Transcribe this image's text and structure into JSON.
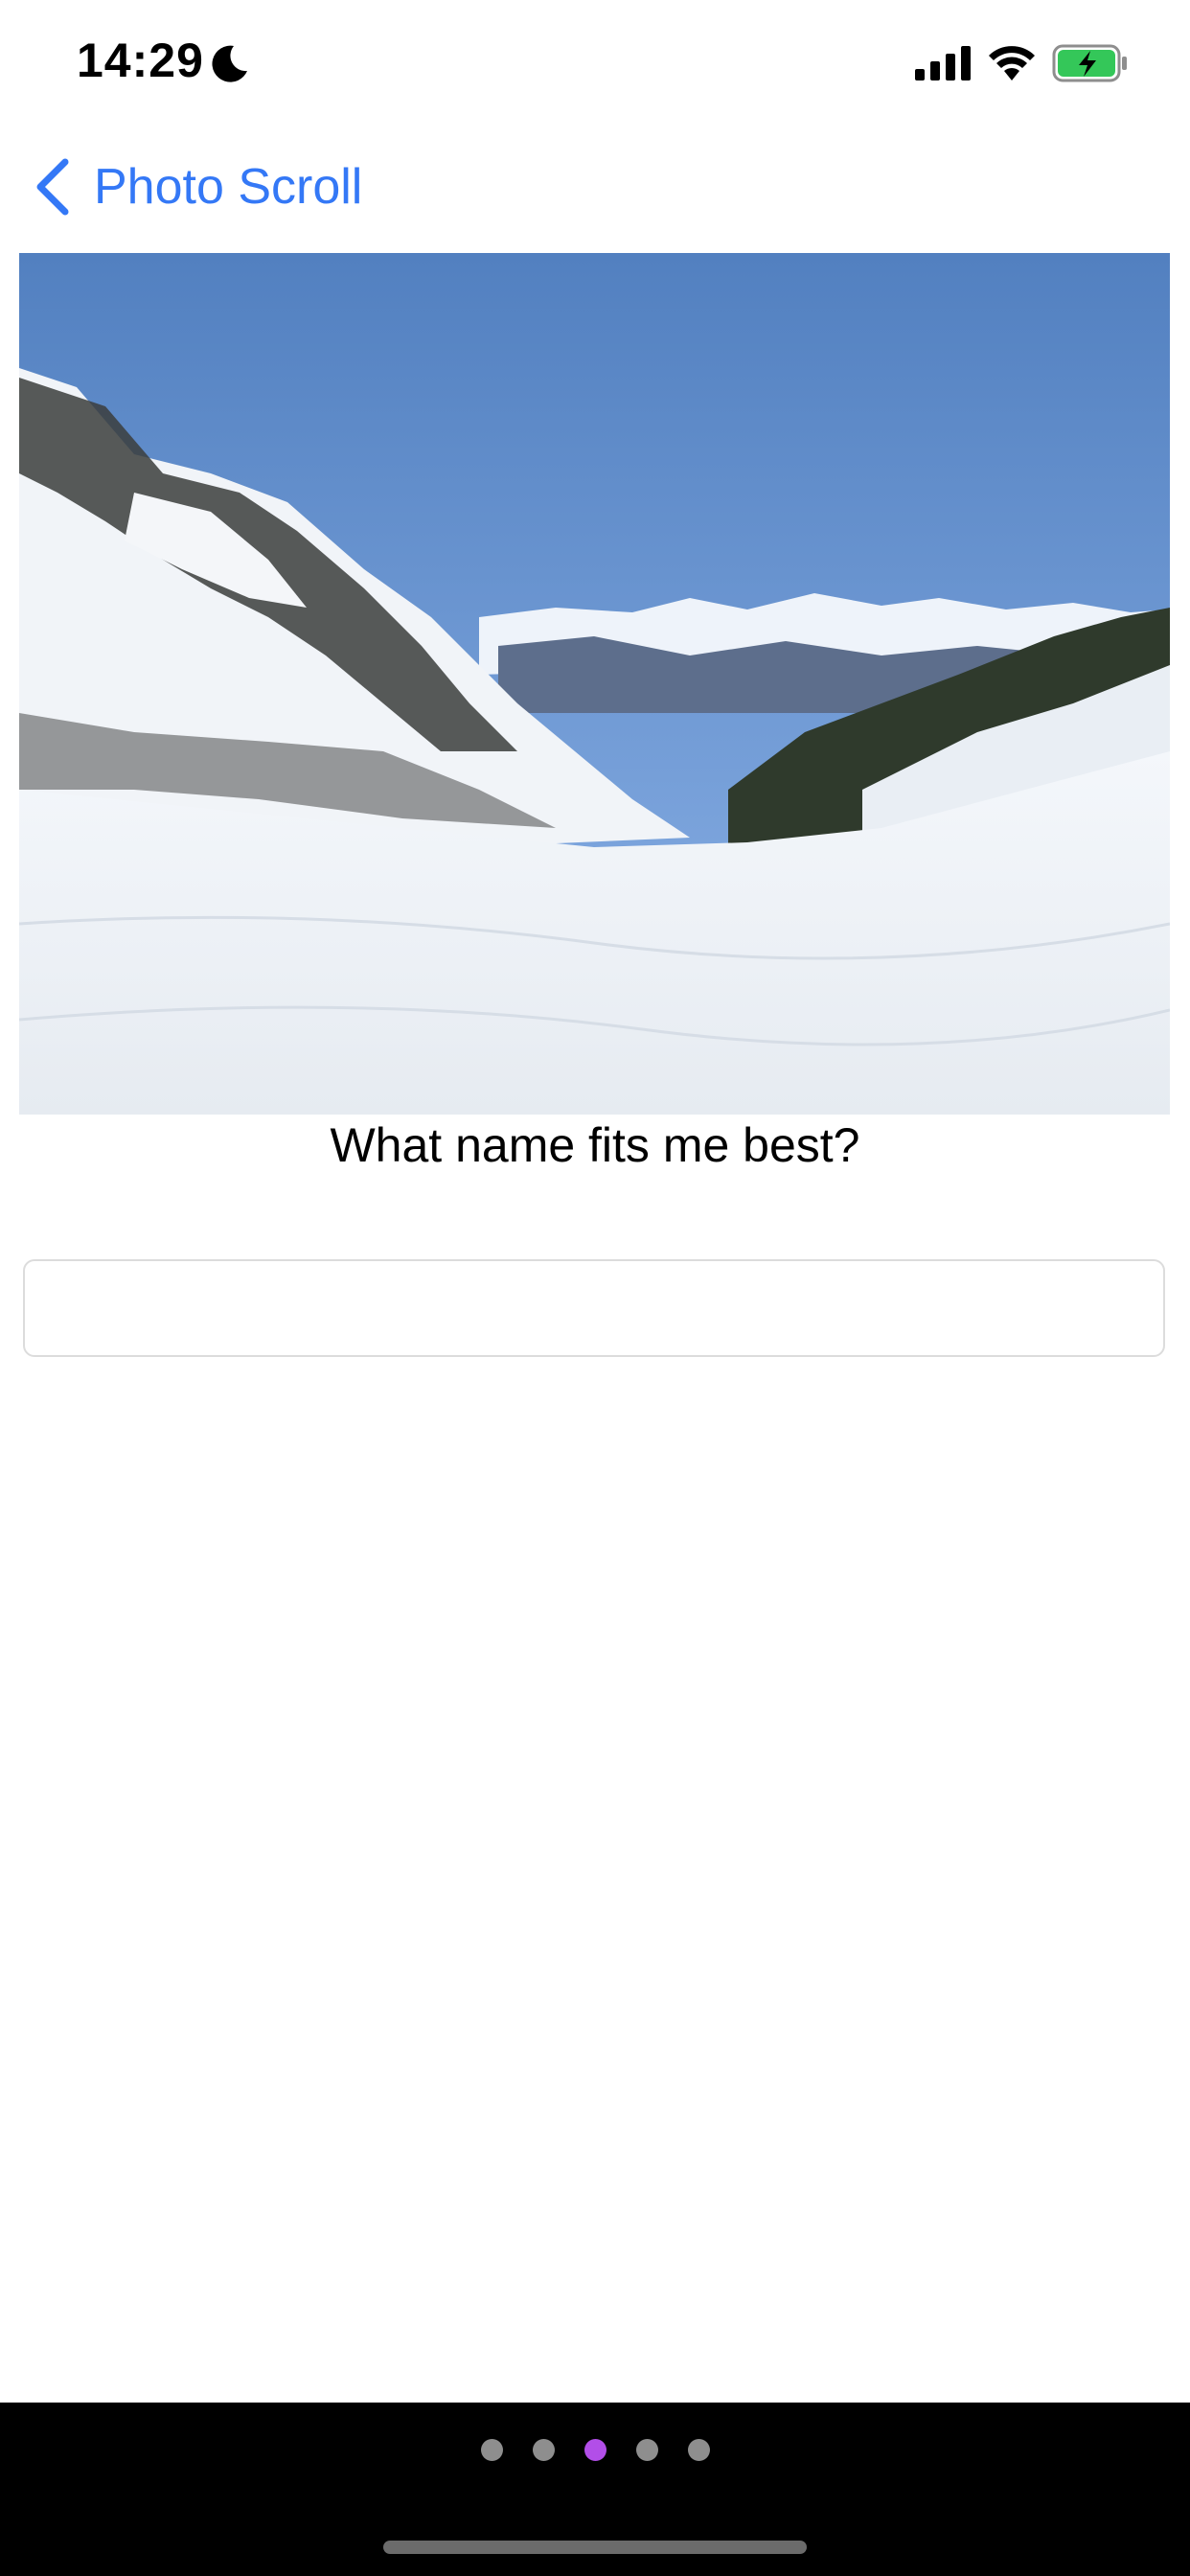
{
  "status_bar": {
    "time": "14:29",
    "icons": [
      "moon-icon",
      "cellular-signal-icon",
      "wifi-icon",
      "battery-charging-icon"
    ]
  },
  "nav": {
    "back_label": "Photo Scroll",
    "back_icon": "chevron-left-icon",
    "accent_color": "#3478f6"
  },
  "photo": {
    "icon": "snowy-mountain-photo"
  },
  "prompt": {
    "text": "What name fits me best?"
  },
  "name_input": {
    "value": "",
    "placeholder": ""
  },
  "pager": {
    "total_pages": 5,
    "current_page": 3,
    "active_color": "#b24ee8",
    "inactive_color": "#8e8e8e"
  }
}
